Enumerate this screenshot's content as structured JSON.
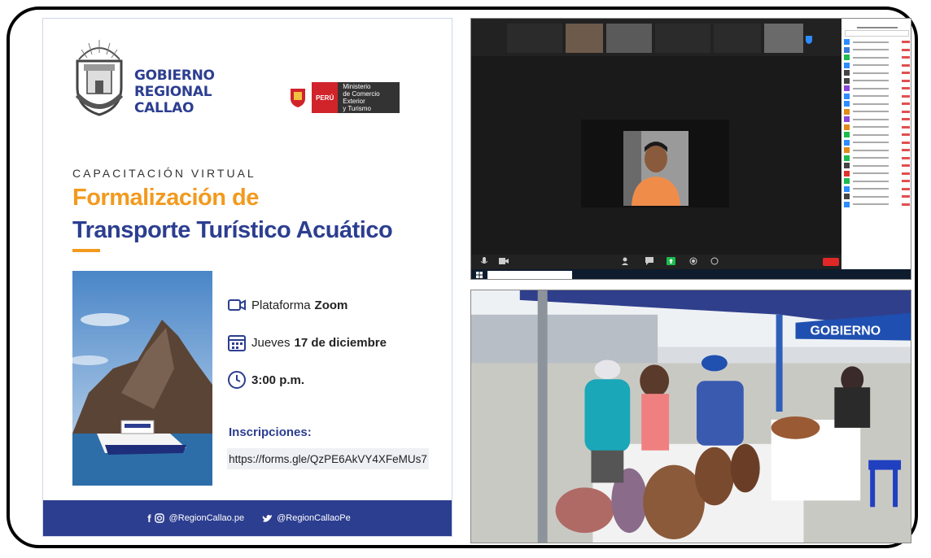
{
  "flyer": {
    "org_name": "GOBIERNO REGIONAL CALLAO",
    "org_lines": [
      "GOBIERNO",
      "REGIONAL",
      "CALLAO"
    ],
    "ministry_peru": "PERÚ",
    "ministry_lines": [
      "Ministerio",
      "de Comercio Exterior",
      "y Turismo"
    ],
    "event_type": "CAPACITACIÓN VIRTUAL",
    "title_line1": "Formalización de",
    "title_line2": "Transporte Turístico Acuático",
    "platform_label": "Plataforma",
    "platform_value": "Zoom",
    "date_label": "Jueves",
    "date_value": "17 de diciembre",
    "time_value": "3:00 p.m.",
    "registration_label": "Inscripciones:",
    "registration_link": "https://forms.gle/QzPE6AkVY4XFeMUs7",
    "social_facebook_instagram": "@RegionCallao.pe",
    "social_twitter": "@RegionCallaoPe",
    "colors": {
      "navy": "#2c3e90",
      "orange": "#f29a1e"
    }
  },
  "event_photo": {
    "banner_text": "GOBIERNO"
  }
}
